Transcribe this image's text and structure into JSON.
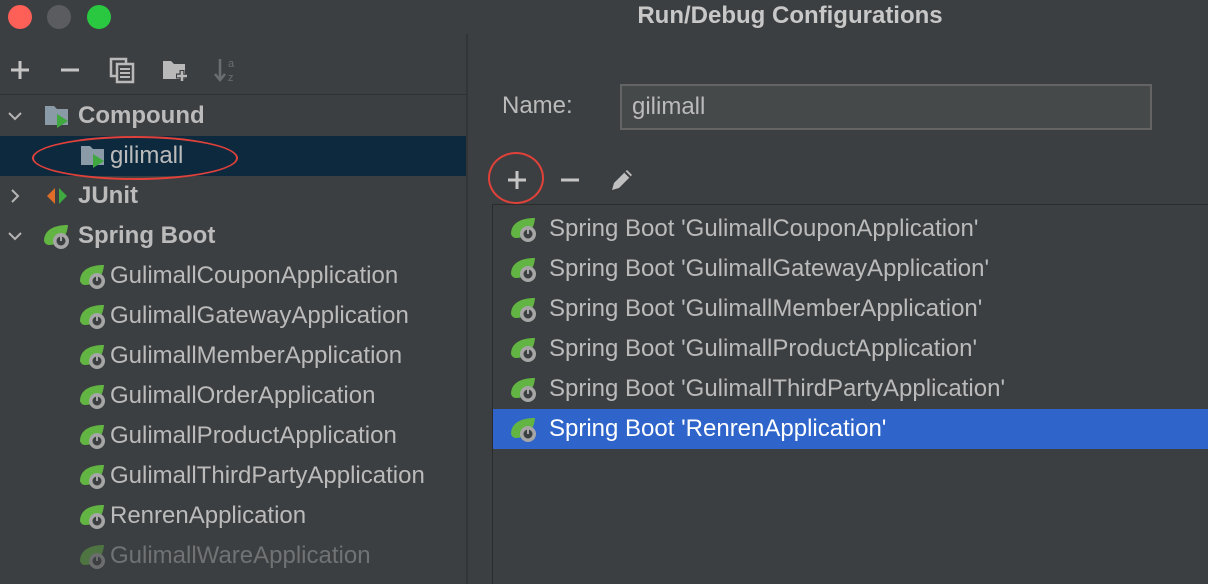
{
  "window": {
    "title": "Run/Debug Configurations"
  },
  "left_toolbar": {
    "icons": [
      "add-icon",
      "remove-icon",
      "copy-icon",
      "new-folder-icon",
      "sort-alpha-icon"
    ]
  },
  "tree": [
    {
      "label": "Compound",
      "bold": true,
      "expanded": true,
      "icon": "compound-icon"
    },
    {
      "label": "gilimall",
      "selected": true,
      "icon": "compound-icon"
    },
    {
      "label": "JUnit",
      "bold": true,
      "expanded": false,
      "icon": "junit-icon"
    },
    {
      "label": "Spring Boot",
      "bold": true,
      "expanded": true,
      "icon": "spring-boot-icon"
    },
    {
      "label": "GulimallCouponApplication",
      "icon": "spring-boot-icon"
    },
    {
      "label": "GulimallGatewayApplication",
      "icon": "spring-boot-icon"
    },
    {
      "label": "GulimallMemberApplication",
      "icon": "spring-boot-icon"
    },
    {
      "label": "GulimallOrderApplication",
      "icon": "spring-boot-icon"
    },
    {
      "label": "GulimallProductApplication",
      "icon": "spring-boot-icon"
    },
    {
      "label": "GulimallThirdPartyApplication",
      "icon": "spring-boot-icon"
    },
    {
      "label": "RenrenApplication",
      "icon": "spring-boot-icon"
    },
    {
      "label": "GulimallWareApplication",
      "icon": "spring-boot-icon",
      "dimmed": true
    }
  ],
  "form": {
    "name_label": "Name:",
    "name_value": "gilimall"
  },
  "compound_toolbar": {
    "icons": [
      "add-icon",
      "remove-icon",
      "edit-pencil-icon"
    ]
  },
  "compound_list": [
    {
      "label": "Spring Boot 'GulimallCouponApplication'"
    },
    {
      "label": "Spring Boot 'GulimallGatewayApplication'"
    },
    {
      "label": "Spring Boot 'GulimallMemberApplication'"
    },
    {
      "label": "Spring Boot 'GulimallProductApplication'"
    },
    {
      "label": "Spring Boot 'GulimallThirdPartyApplication'"
    },
    {
      "label": "Spring Boot 'RenrenApplication'",
      "selected": true
    }
  ],
  "colors": {
    "background": "#3c3f41",
    "tree_selection": "#0d293e",
    "list_selection": "#2f65ca",
    "annotation": "#e0413a",
    "spring_green": "#62b543"
  }
}
